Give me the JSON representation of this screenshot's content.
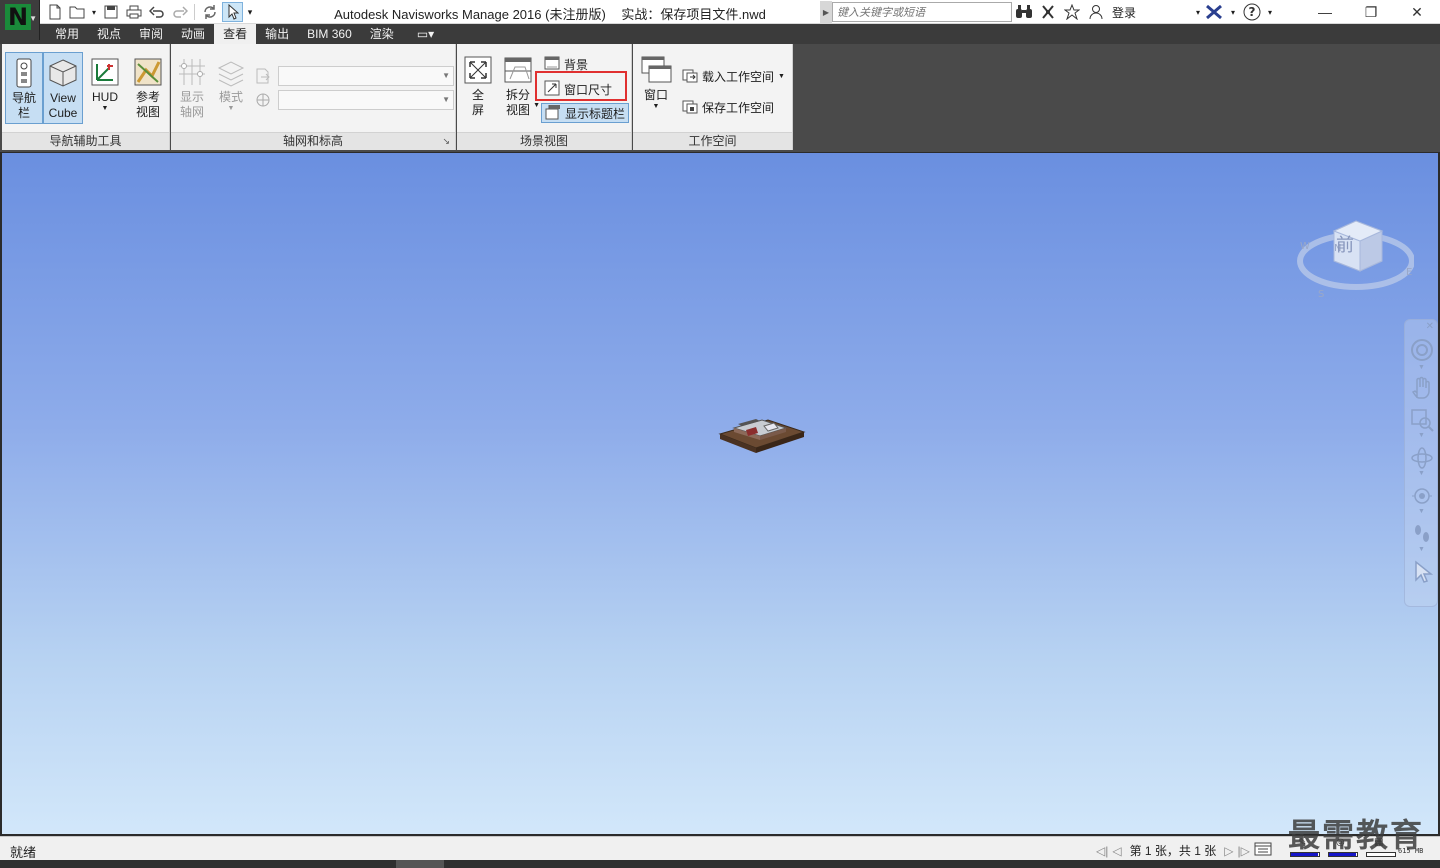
{
  "app": {
    "title": "Autodesk Navisworks Manage 2016 (未注册版)",
    "document": "实战：保存项目文件.nwd",
    "logo_letter": "N"
  },
  "search": {
    "placeholder": "键入关键字或短语"
  },
  "account": {
    "signin_label": "登录"
  },
  "ribbon_tabs": [
    {
      "label": "常用"
    },
    {
      "label": "视点"
    },
    {
      "label": "审阅"
    },
    {
      "label": "动画"
    },
    {
      "label": "查看",
      "active": true
    },
    {
      "label": "输出"
    },
    {
      "label": "BIM 360"
    },
    {
      "label": "渲染"
    }
  ],
  "panels": {
    "nav_aids": {
      "title": "导航辅助工具",
      "navbar_label_1": "导航",
      "navbar_label_2": "栏",
      "viewcube_label_1": "View",
      "viewcube_label_2": "Cube",
      "hud_label": "HUD",
      "refview_label_1": "参考",
      "refview_label_2": "视图"
    },
    "grids": {
      "title": "轴网和标高",
      "showgrid_label_1": "显示",
      "showgrid_label_2": "轴网",
      "mode_label": "模式"
    },
    "scene_view": {
      "title": "场景视图",
      "fullscreen_label_1": "全",
      "fullscreen_label_2": "屏",
      "split_label_1": "拆分",
      "split_label_2": "视图",
      "background_label": "背景",
      "window_size_label": "窗口尺寸",
      "show_titlebar_label": "显示标题栏"
    },
    "workspace": {
      "title": "工作空间",
      "windows_label": "窗口",
      "load_label": "载入工作空间",
      "save_label": "保存工作空间"
    }
  },
  "viewcube": {
    "face_label": "前"
  },
  "status": {
    "text": "就绪",
    "page_text": "第 1 张，共 1 张",
    "memory": "615 MB",
    "meter_levels": [
      0.95,
      0.95,
      0.0
    ]
  },
  "watermark": "最需教育",
  "colors": {
    "highlight": "#e03030",
    "ribbon_dark": "#3b3b3b",
    "pressed": "#c6def3",
    "viewport_top": "#6a8fe0",
    "viewport_bottom": "#d2e7fa"
  }
}
